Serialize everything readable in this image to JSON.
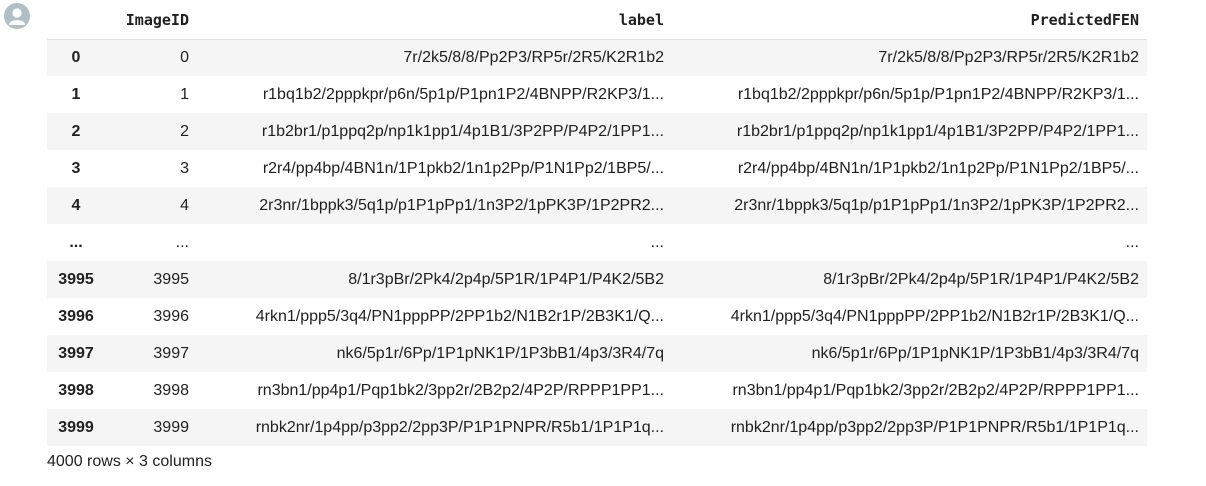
{
  "dataframe": {
    "columns": [
      "ImageID",
      "label",
      "PredictedFEN"
    ],
    "rows": [
      {
        "index": "0",
        "ImageID": "0",
        "label": "7r/2k5/8/8/Pp2P3/RP5r/2R5/K2R1b2",
        "PredictedFEN": "7r/2k5/8/8/Pp2P3/RP5r/2R5/K2R1b2"
      },
      {
        "index": "1",
        "ImageID": "1",
        "label": "r1bq1b2/2pppkpr/p6n/5p1p/P1pn1P2/4BNPP/R2KP3/1...",
        "PredictedFEN": "r1bq1b2/2pppkpr/p6n/5p1p/P1pn1P2/4BNPP/R2KP3/1..."
      },
      {
        "index": "2",
        "ImageID": "2",
        "label": "r1b2br1/p1ppq2p/np1k1pp1/4p1B1/3P2PP/P4P2/1PP1...",
        "PredictedFEN": "r1b2br1/p1ppq2p/np1k1pp1/4p1B1/3P2PP/P4P2/1PP1..."
      },
      {
        "index": "3",
        "ImageID": "3",
        "label": "r2r4/pp4bp/4BN1n/1P1pkb2/1n1p2Pp/P1N1Pp2/1BP5/...",
        "PredictedFEN": "r2r4/pp4bp/4BN1n/1P1pkb2/1n1p2Pp/P1N1Pp2/1BP5/..."
      },
      {
        "index": "4",
        "ImageID": "4",
        "label": "2r3nr/1bppk3/5q1p/p1P1pPp1/1n3P2/1pPK3P/1P2PR2...",
        "PredictedFEN": "2r3nr/1bppk3/5q1p/p1P1pPp1/1n3P2/1pPK3P/1P2PR2..."
      },
      {
        "index": "...",
        "ImageID": "...",
        "label": "...",
        "PredictedFEN": "..."
      },
      {
        "index": "3995",
        "ImageID": "3995",
        "label": "8/1r3pBr/2Pk4/2p4p/5P1R/1P4P1/P4K2/5B2",
        "PredictedFEN": "8/1r3pBr/2Pk4/2p4p/5P1R/1P4P1/P4K2/5B2"
      },
      {
        "index": "3996",
        "ImageID": "3996",
        "label": "4rkn1/ppp5/3q4/PN1pppPP/2PP1b2/N1B2r1P/2B3K1/Q...",
        "PredictedFEN": "4rkn1/ppp5/3q4/PN1pppPP/2PP1b2/N1B2r1P/2B3K1/Q..."
      },
      {
        "index": "3997",
        "ImageID": "3997",
        "label": "nk6/5p1r/6Pp/1P1pNK1P/1P3bB1/4p3/3R4/7q",
        "PredictedFEN": "nk6/5p1r/6Pp/1P1pNK1P/1P3bB1/4p3/3R4/7q"
      },
      {
        "index": "3998",
        "ImageID": "3998",
        "label": "rn3bn1/pp4p1/Pqp1bk2/3pp2r/2B2p2/4P2P/RPPP1PP1...",
        "PredictedFEN": "rn3bn1/pp4p1/Pqp1bk2/3pp2r/2B2p2/4P2P/RPPP1PP1..."
      },
      {
        "index": "3999",
        "ImageID": "3999",
        "label": "rnbk2nr/1p4pp/p3pp2/2pp3P/P1P1PNPR/R5b1/1P1P1q...",
        "PredictedFEN": "rnbk2nr/1p4pp/p3pp2/2pp3P/P1P1PNPR/R5b1/1P1P1q..."
      }
    ],
    "shape_text": "4000 rows × 3 columns"
  },
  "icons": {
    "avatar": "user-avatar-icon"
  },
  "colors": {
    "row_stripe": "#f5f5f5",
    "avatar": "#b0bec5"
  }
}
